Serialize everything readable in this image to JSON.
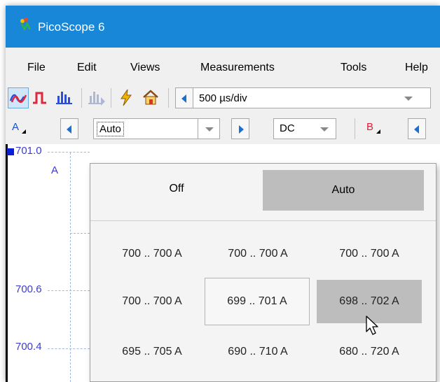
{
  "window": {
    "title": "PicoScope 6"
  },
  "menu": {
    "items": [
      "File",
      "Edit",
      "Views",
      "Measurements",
      "Tools",
      "Help"
    ]
  },
  "toolbar": {
    "timebase": "500 µs/div"
  },
  "channel_a": {
    "label": "A",
    "range_value": "Auto",
    "coupling": "DC"
  },
  "channel_b": {
    "label": "B"
  },
  "scope": {
    "y_labels": [
      "701.0",
      "A",
      "700.6",
      "700.4"
    ]
  },
  "range_dropdown": {
    "mode_buttons": [
      "Off",
      "Auto"
    ],
    "ranges": [
      [
        "700 .. 700 A",
        "700 .. 700 A",
        "700 .. 700 A"
      ],
      [
        "700 .. 700 A",
        "699 .. 701 A",
        "698 .. 702 A"
      ],
      [
        "695 .. 705 A",
        "690 .. 710 A",
        "680 .. 720 A"
      ]
    ]
  },
  "colors": {
    "titlebar": "#1887d8",
    "accent_blue": "#1a6fd0",
    "channel_b": "#d81f3c",
    "hover_gray": "#bdbdbd"
  }
}
